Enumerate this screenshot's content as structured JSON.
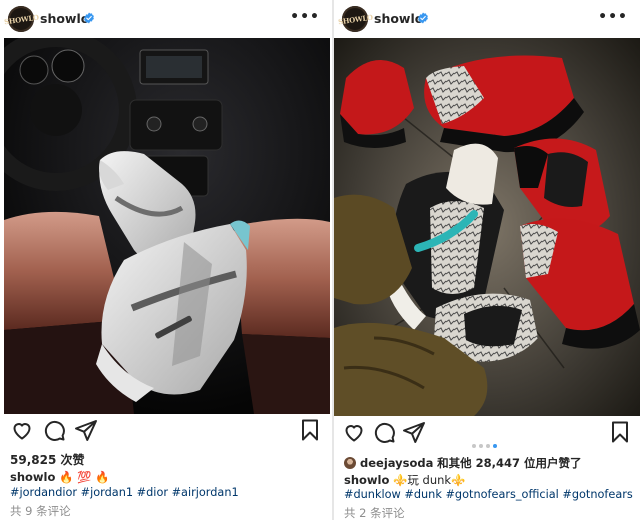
{
  "posts": [
    {
      "username": "showlo",
      "avatar_text": "SHOWLO",
      "likes": "59,825 次赞",
      "caption_user": "showlo",
      "caption_text": "🔥 💯 🔥",
      "hashtags": "#jordandior #jordan1 #dior #airjordan1",
      "comments": "共 9 条评论",
      "photo_description": "Air Jordan 1 Dior sneakers on car seat"
    },
    {
      "username": "showlo",
      "avatar_text": "SHOWLO",
      "liked_by_user": "deejaysoda",
      "liked_by_text": "和其他 28,447 位用户赞了",
      "caption_user": "showlo",
      "caption_text": "⚜️玩 dunk⚜️",
      "hashtags": "#dunklow #dunk #gotnofears_official #gotnofears",
      "comments": "共 2 条评论",
      "carousel": {
        "count": 4,
        "active": 4
      },
      "photo_description": "Nike Dunk sneakers in a circle"
    }
  ],
  "colors": {
    "verified": "#3897f0",
    "hashtag": "#00376b",
    "muted": "#8e8e8e",
    "text": "#262626"
  },
  "icons": [
    "heart-icon",
    "comment-icon",
    "share-icon",
    "bookmark-icon",
    "verified-badge-icon",
    "more-options-icon"
  ]
}
